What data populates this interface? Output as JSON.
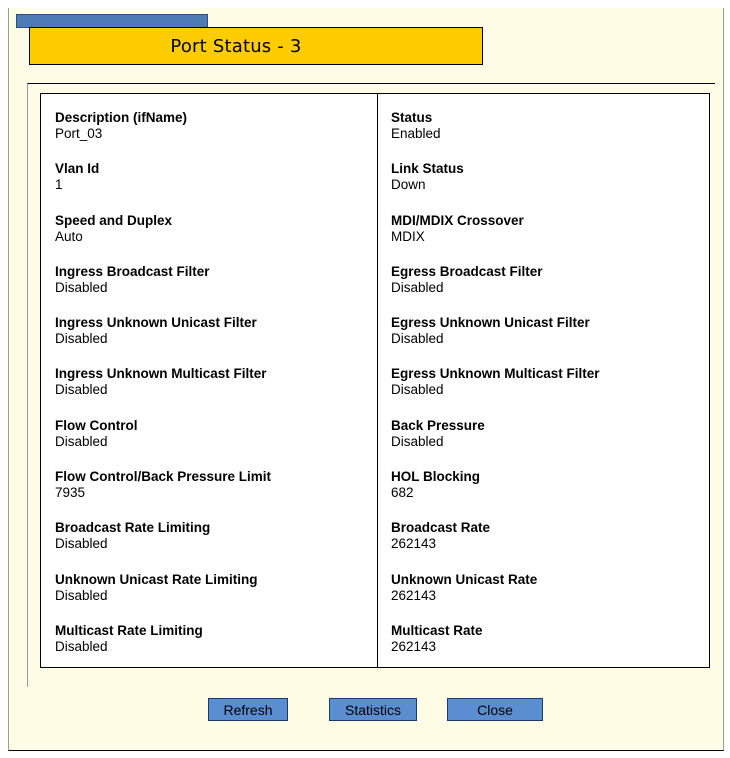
{
  "dialog": {
    "title": "Port Status - 3"
  },
  "left_fields": [
    {
      "label": "Description (ifName)",
      "value": "Port_03"
    },
    {
      "label": "Vlan Id",
      "value": "1"
    },
    {
      "label": "Speed and Duplex",
      "value": "Auto"
    },
    {
      "label": "Ingress Broadcast Filter",
      "value": "Disabled"
    },
    {
      "label": "Ingress Unknown Unicast Filter",
      "value": "Disabled"
    },
    {
      "label": "Ingress Unknown Multicast Filter",
      "value": "Disabled"
    },
    {
      "label": "Flow Control",
      "value": "Disabled"
    },
    {
      "label": "Flow Control/Back Pressure Limit",
      "value": "7935"
    },
    {
      "label": "Broadcast Rate Limiting",
      "value": "Disabled"
    },
    {
      "label": "Unknown Unicast Rate Limiting",
      "value": "Disabled"
    },
    {
      "label": "Multicast Rate Limiting",
      "value": "Disabled"
    }
  ],
  "right_fields": [
    {
      "label": "Status",
      "value": "Enabled"
    },
    {
      "label": "Link Status",
      "value": "Down"
    },
    {
      "label": "MDI/MDIX Crossover",
      "value": "MDIX"
    },
    {
      "label": "Egress Broadcast Filter",
      "value": "Disabled"
    },
    {
      "label": "Egress Unknown Unicast Filter",
      "value": "Disabled"
    },
    {
      "label": "Egress Unknown Multicast Filter",
      "value": "Disabled"
    },
    {
      "label": "Back Pressure",
      "value": "Disabled"
    },
    {
      "label": "HOL Blocking",
      "value": "682"
    },
    {
      "label": "Broadcast Rate",
      "value": "262143"
    },
    {
      "label": "Unknown Unicast Rate",
      "value": "262143"
    },
    {
      "label": "Multicast Rate",
      "value": "262143"
    }
  ],
  "buttons": {
    "refresh": "Refresh",
    "statistics": "Statistics",
    "close": "Close"
  },
  "colors": {
    "title_tab": "#ffcc00",
    "tab_strip": "#4e7ab8",
    "window_background": "#fffde6",
    "button": "#5a8ed0"
  }
}
